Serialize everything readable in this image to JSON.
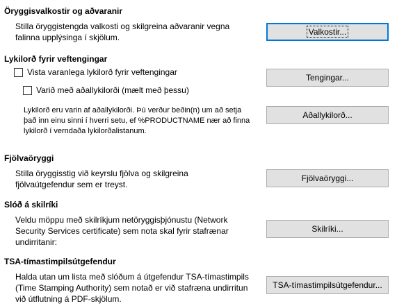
{
  "security_options": {
    "heading": "Öryggisvalkostir og aðvaranir",
    "desc_line1": "Stilla öryggistengda valkosti og skilgreina aðvaranir vegna",
    "desc_line2": "falinna upplýsinga í skjölum.",
    "button_label": "Valkostir..."
  },
  "web_passwords": {
    "heading": "Lykilorð fyrir veftengingar",
    "persist_checkbox_label": "Vista varanlega lykilorð fyrir veftengingar",
    "persist_checked": false,
    "master_checkbox_label": "Varið með aðallykilorði (mælt með þessu)",
    "master_checked": false,
    "connections_button_label": "Tengingar...",
    "info_line1": "Lykilorð eru varin af aðallykilorði. Þú verður beðin(n) um að setja",
    "info_line2": "það inn einu sinni í hverri setu, ef %PRODUCTNAME nær að finna",
    "info_line3": "lykilorð í verndaða lykilorðalistanum.",
    "master_button_label": "Aðallykilorð..."
  },
  "macro_security": {
    "heading": "Fjölvaöryggi",
    "desc_line1": "Stilla öryggisstig við keyrslu fjölva og skilgreina",
    "desc_line2": "fjölvaútgefendur sem er treyst.",
    "button_label": "Fjölvaöryggi..."
  },
  "certificate_path": {
    "heading": "Slóð á skilríki",
    "desc_line1": "Veldu möppu með skilríkjum netöryggisþjónustu (Network",
    "desc_line2": "Security Services certificate) sem nota skal fyrir stafrænar",
    "desc_line3": "undirritanir:",
    "button_label": "Skilríki..."
  },
  "tsa": {
    "heading": "TSA-tímastimpilsútgefendur",
    "desc_line1": "Halda utan um lista með slóðum á útgefendur TSA-tímastimpils",
    "desc_line2": "(Time Stamping Authority) sem notað er við stafræna undirritun",
    "desc_line3": "við útflutning á PDF-skjölum.",
    "button_label": "TSA-tímastimpilsútgefendur..."
  }
}
